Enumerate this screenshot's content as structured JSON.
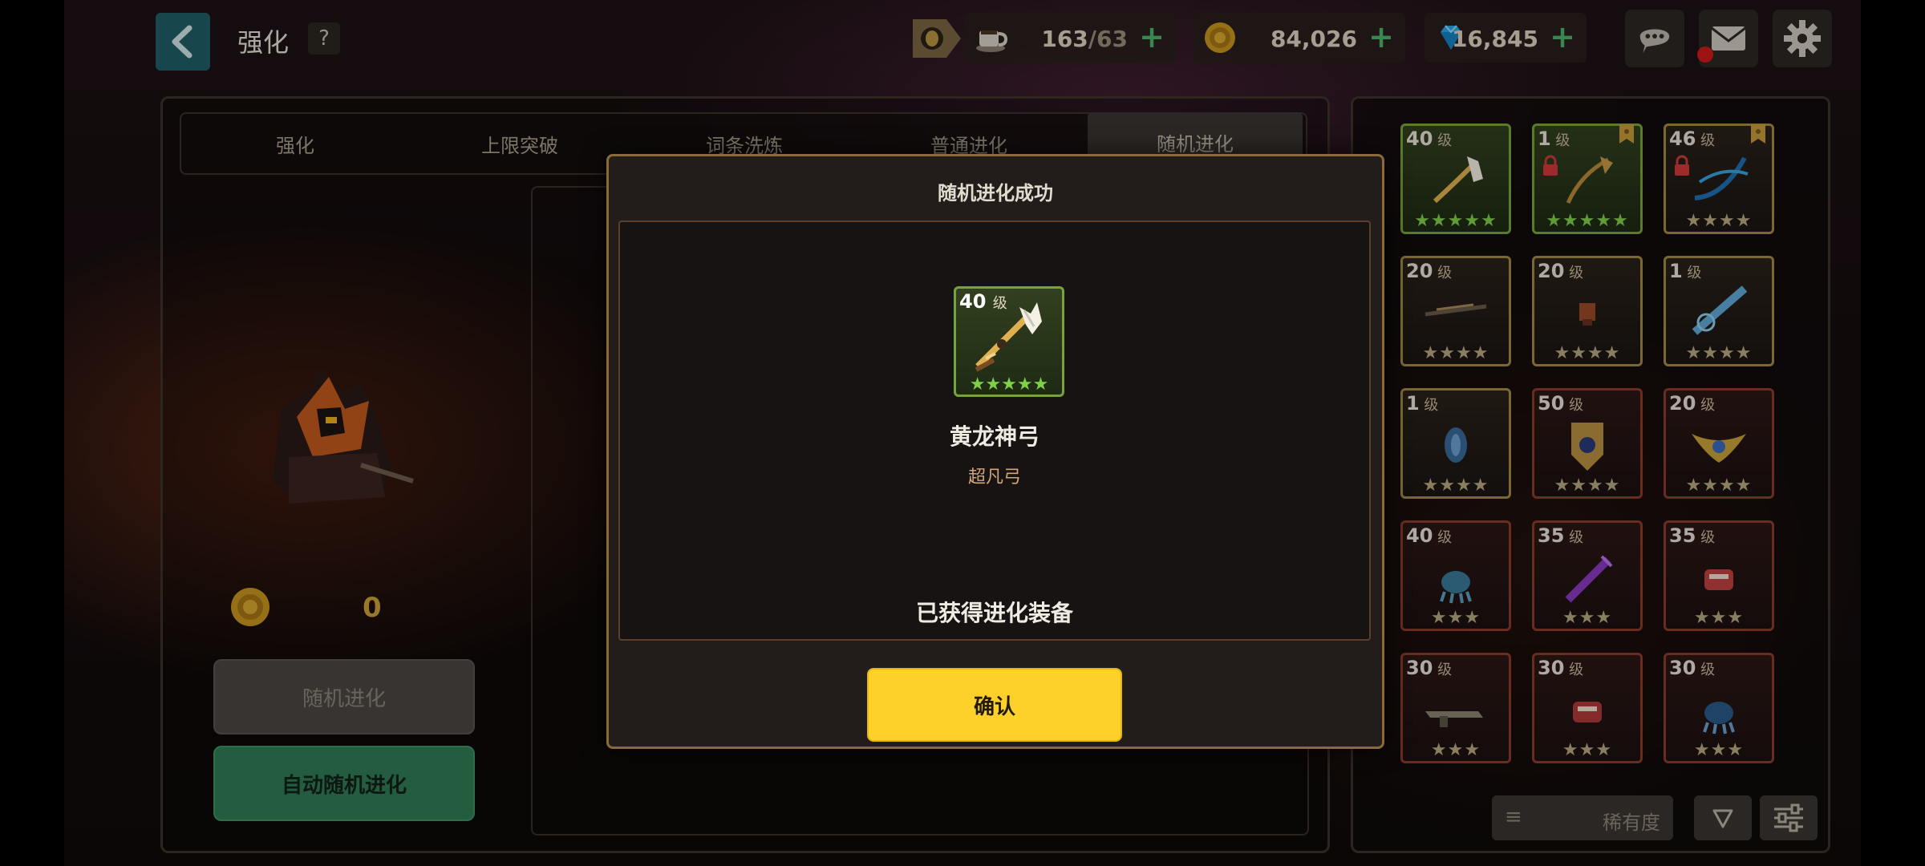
{
  "header": {
    "title": "强化",
    "help_label": "?",
    "stamina": {
      "current": "163",
      "max": "/63"
    },
    "gold": "84,026",
    "gems": "16,845",
    "plus": "+"
  },
  "tabs": [
    {
      "label": "强化"
    },
    {
      "label": "上限突破"
    },
    {
      "label": "词条洗炼"
    },
    {
      "label": "普通进化"
    },
    {
      "label": "随机进化"
    }
  ],
  "left": {
    "coin_count": "0",
    "random_evolve_label": "随机进化",
    "auto_evolve_label": "自动随机进化"
  },
  "inventory": {
    "level_suffix": "级",
    "items": [
      {
        "level": "40",
        "stars": "★★★★★",
        "rarity": "green"
      },
      {
        "level": "1",
        "stars": "★★★★★",
        "rarity": "green"
      },
      {
        "level": "46",
        "stars": "★★★★",
        "rarity": "gold"
      },
      {
        "level": "20",
        "stars": "★★★★",
        "rarity": "gold"
      },
      {
        "level": "20",
        "stars": "★★★★",
        "rarity": "gold"
      },
      {
        "level": "1",
        "stars": "★★★★",
        "rarity": "gold"
      },
      {
        "level": "1",
        "stars": "★★★★",
        "rarity": "gold"
      },
      {
        "level": "50",
        "stars": "★★★★",
        "rarity": "red"
      },
      {
        "level": "20",
        "stars": "★★★★",
        "rarity": "red"
      },
      {
        "level": "40",
        "stars": "★★★",
        "rarity": "red"
      },
      {
        "level": "35",
        "stars": "★★★",
        "rarity": "red"
      },
      {
        "level": "35",
        "stars": "★★★",
        "rarity": "red"
      },
      {
        "level": "30",
        "stars": "★★★",
        "rarity": "red"
      },
      {
        "level": "30",
        "stars": "★★★",
        "rarity": "red"
      },
      {
        "level": "30",
        "stars": "★★★",
        "rarity": "red"
      }
    ],
    "sort_label": "稀有度",
    "sort_lines": "≡"
  },
  "modal": {
    "title": "随机进化成功",
    "reward_level": "40",
    "reward_level_suffix": "级",
    "reward_stars": "★★★★★",
    "reward_name": "黄龙神弓",
    "reward_type": "超凡弓",
    "message": "已获得进化装备",
    "confirm_label": "确认"
  },
  "colors": {
    "accent_yellow": "#fdd02a",
    "green_button": "#2f7b53",
    "rarity_green": "#77a43a",
    "rarity_gold": "#a58a46",
    "rarity_red": "#8b3b2c"
  }
}
